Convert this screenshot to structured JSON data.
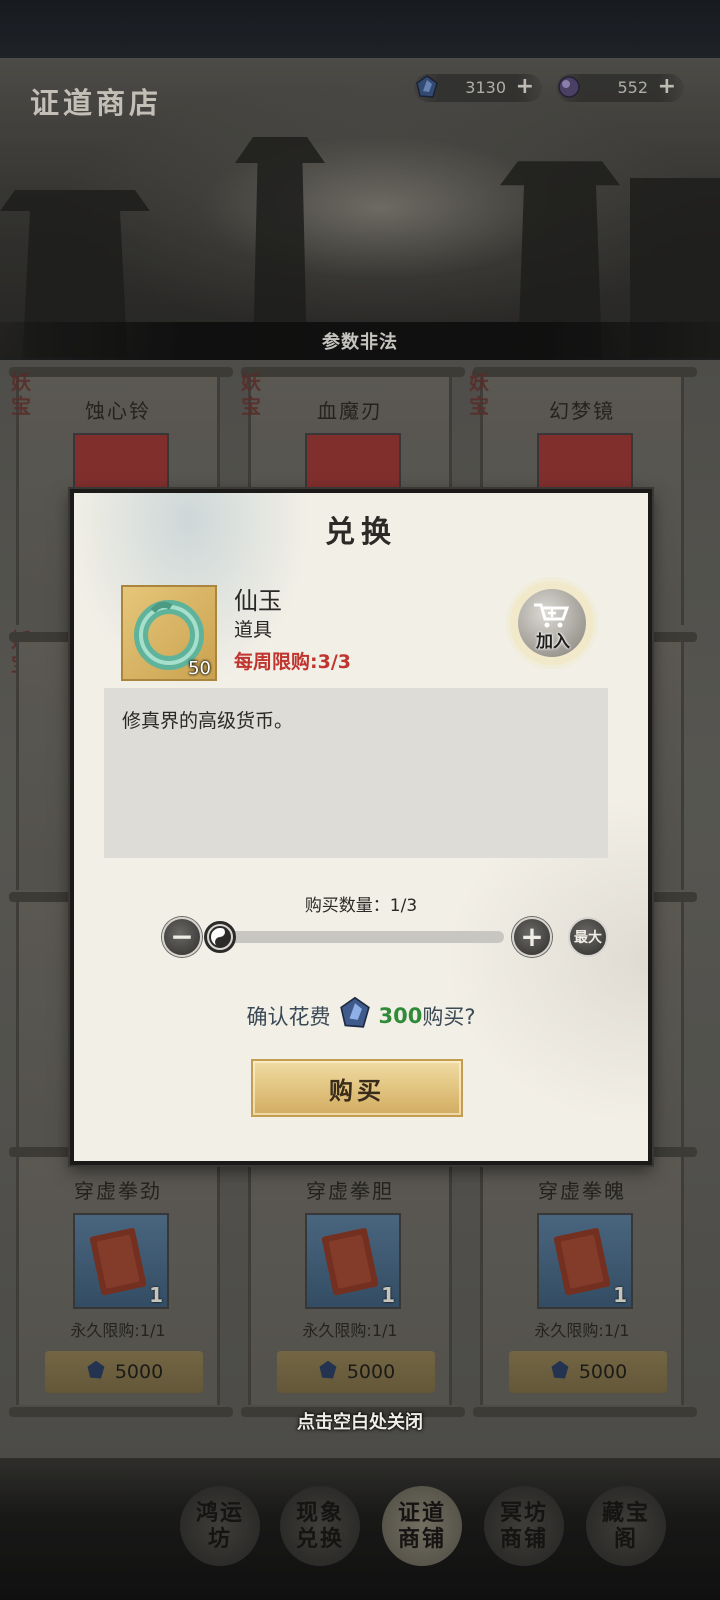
{
  "header": {
    "title": "证道商店",
    "currencies": [
      {
        "icon": "spirit-stone-icon",
        "value": "3130"
      },
      {
        "icon": "spirit-orb-icon",
        "value": "552"
      }
    ],
    "plus": "+",
    "banner": "参数非法"
  },
  "shop": {
    "tag_text": "妖宝",
    "row1": [
      {
        "name": "蚀心铃"
      },
      {
        "name": "血魔刃"
      },
      {
        "name": "幻梦镜"
      }
    ],
    "row4": [
      {
        "name": "穿虚拳劲",
        "qty": "1",
        "limit": "永久限购:1/1",
        "price": "5000"
      },
      {
        "name": "穿虚拳胆",
        "qty": "1",
        "limit": "永久限购:1/1",
        "price": "5000"
      },
      {
        "name": "穿虚拳魄",
        "qty": "1",
        "limit": "永久限购:1/1",
        "price": "5000"
      }
    ]
  },
  "modal": {
    "title": "兑换",
    "item": {
      "name": "仙玉",
      "type": "道具",
      "limit": "每周限购:3/3",
      "qty": "50",
      "description": "修真界的高级货币。"
    },
    "add_label": "加入",
    "quantity_label": "购买数量：1/3",
    "quantity": {
      "current": 1,
      "max": 3
    },
    "minus": "−",
    "plus": "+",
    "max_label": "最大",
    "confirm_prefix": "确认花费",
    "confirm_amount": "300",
    "confirm_suffix": "购买?",
    "buy_label": "购买",
    "close_hint": "点击空白处关闭"
  },
  "nav": {
    "items": [
      {
        "label": "鸿运坊"
      },
      {
        "label": "现象兑换"
      },
      {
        "label": "证道商铺"
      },
      {
        "label": "冥坊商铺"
      },
      {
        "label": "藏宝阁"
      }
    ]
  },
  "colors": {
    "limit_red": "#c0352f",
    "amount_green": "#2f8a3a",
    "gold_button": "#e0c27c"
  }
}
